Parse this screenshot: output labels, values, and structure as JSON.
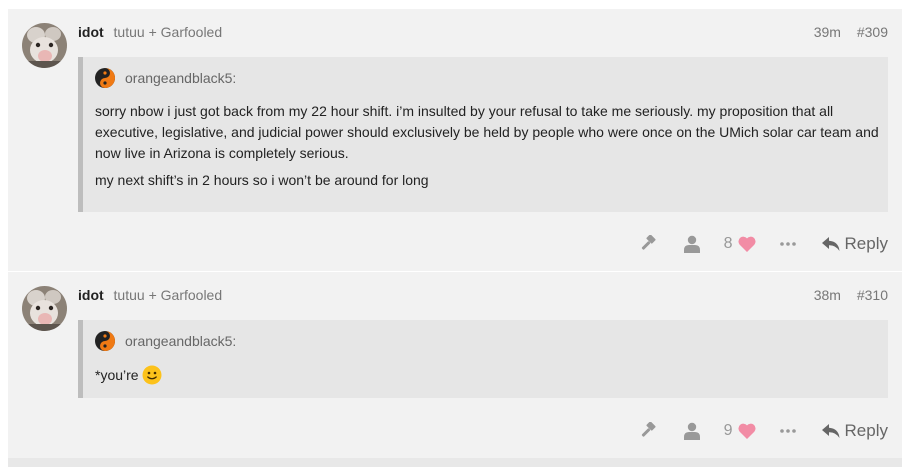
{
  "posts": [
    {
      "username": "idot",
      "groups": "tutuu + Garfooled",
      "time": "39m",
      "number": "#309",
      "quote": {
        "author": "orangeandblack5:",
        "paragraphs": [
          "sorry nbow i just got back from my 22 hour shift. i’m insulted by your refusal to take me seriously. my proposition that all executive, legislative, and judicial power should exclusively be held by people who were once on the UMich solar car team and now live in Arizona is completely serious.",
          "my next shift’s in 2 hours so i won’t be around for long"
        ]
      },
      "likes": "8",
      "reply_label": "Reply"
    },
    {
      "username": "idot",
      "groups": "tutuu + Garfooled",
      "time": "38m",
      "number": "#310",
      "quote": {
        "author": "orangeandblack5:",
        "paragraphs": [
          "*you’re"
        ]
      },
      "likes": "9",
      "reply_label": "Reply"
    }
  ],
  "icons": {
    "moderator": "gavel-icon",
    "user": "user-icon",
    "like": "heart-icon",
    "more": "ellipsis-icon",
    "reply": "reply-arrow-icon",
    "emoji": "slight-smile-emoji"
  },
  "colors": {
    "heart": "#f28ca5",
    "post_background": "#f2f2f2",
    "quote_background": "#e6e6e6",
    "quote_border": "#bdbdbd"
  }
}
